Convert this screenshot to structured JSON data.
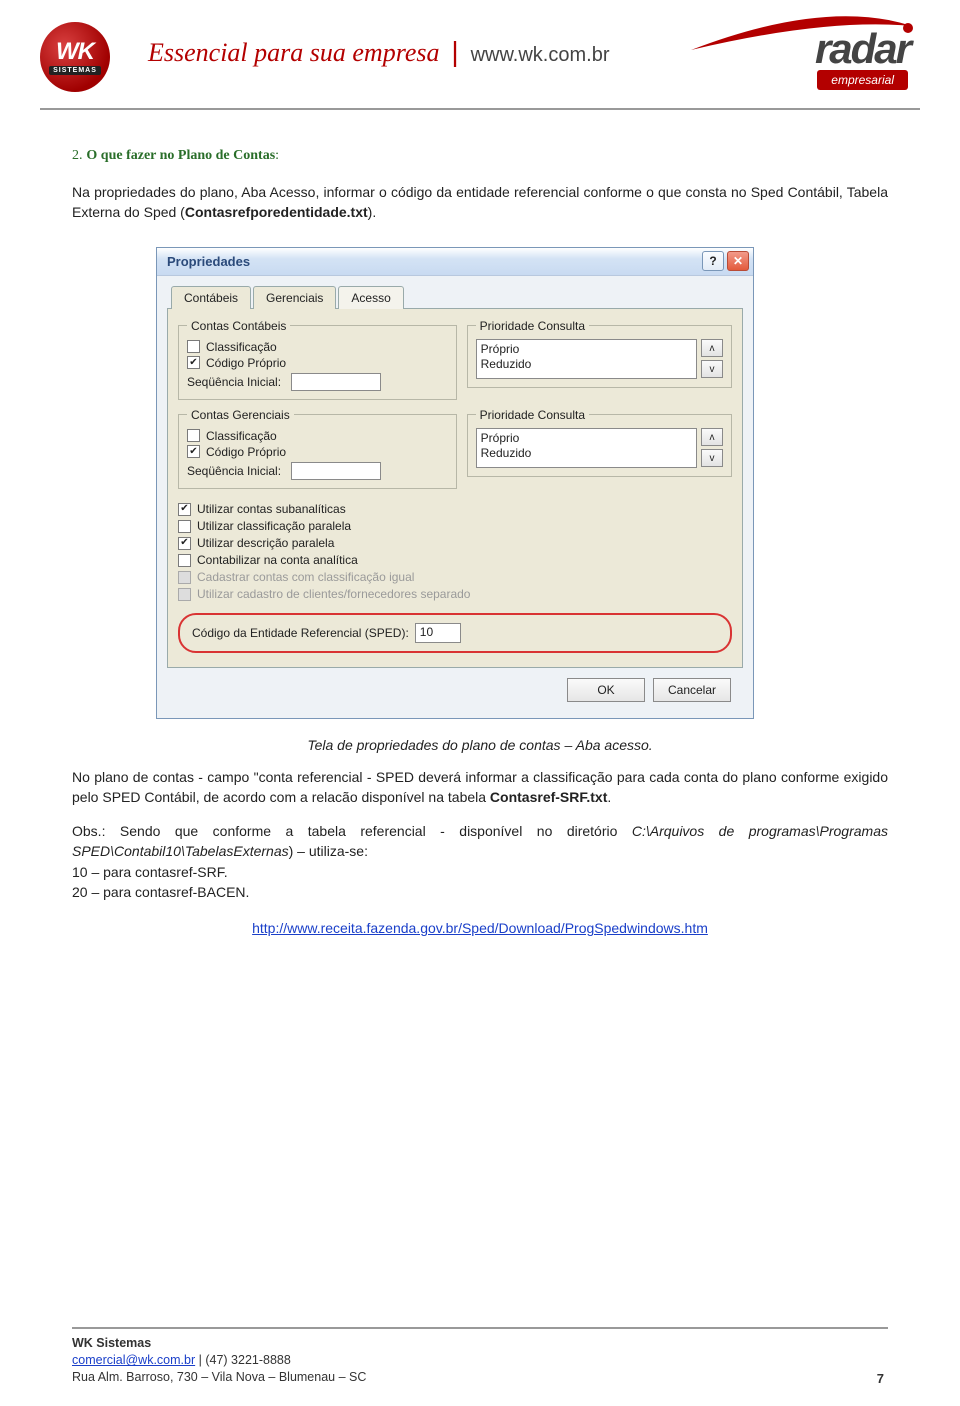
{
  "header": {
    "wk_text": "WK",
    "wk_sub": "SISTEMAS",
    "tagline": "Essencial para sua empresa",
    "site": "www.wk.com.br",
    "radar": "radar",
    "radar_sub": "empresarial"
  },
  "section": {
    "num": "2.",
    "title": "O que fazer no Plano de Contas",
    "colon": ":",
    "intro": "Na propriedades do plano, Aba Acesso, informar o código da entidade referencial conforme o que consta no Sped Contábil, Tabela Externa do Sped (",
    "intro_bold": "Contasrefporedentidade.txt",
    "intro_end": ")."
  },
  "dialog": {
    "title": "Propriedades",
    "help": "?",
    "close": "✕",
    "tabs": [
      "Contábeis",
      "Gerenciais",
      "Acesso"
    ],
    "groups": {
      "contas_contabeis": {
        "legend": "Contas Contábeis",
        "classificacao": "Classificação",
        "codigo_proprio": "Código Próprio",
        "sequencia": "Seqüência Inicial:"
      },
      "contas_gerenciais": {
        "legend": "Contas Gerenciais",
        "classificacao": "Classificação",
        "codigo_proprio": "Código Próprio",
        "sequencia": "Seqüência Inicial:"
      },
      "prioridade1": {
        "legend": "Prioridade Consulta",
        "items": [
          "Próprio",
          "Reduzido"
        ]
      },
      "prioridade2": {
        "legend": "Prioridade Consulta",
        "items": [
          "Próprio",
          "Reduzido"
        ]
      }
    },
    "options": [
      {
        "label": "Utilizar contas subanalíticas",
        "checked": true,
        "disabled": false
      },
      {
        "label": "Utilizar classificação paralela",
        "checked": false,
        "disabled": false
      },
      {
        "label": "Utilizar descrição paralela",
        "checked": true,
        "disabled": false
      },
      {
        "label": "Contabilizar na conta analítica",
        "checked": false,
        "disabled": false
      },
      {
        "label": "Cadastrar contas com classificação igual",
        "checked": false,
        "disabled": true
      },
      {
        "label": "Utilizar cadastro de clientes/fornecedores separado",
        "checked": false,
        "disabled": true
      }
    ],
    "sped_label": "Código da Entidade Referencial (SPED):",
    "sped_value": "10",
    "ok": "OK",
    "cancel": "Cancelar"
  },
  "caption": "Tela de propriedades do plano de contas – Aba acesso.",
  "para2_a": "No plano de contas - campo \"conta referencial - SPED deverá informar a classificação para cada conta do plano conforme exigido pelo SPED Contábil, de acordo com a relacão disponível na tabela ",
  "para2_b": "Contasref-SRF.txt",
  "para2_c": ".",
  "obs_a": "Obs.: Sendo que conforme a tabela referencial - disponível no diretório ",
  "obs_i": "C:\\Arquivos de programas\\Programas SPED\\Contabil10\\TabelasExternas",
  "obs_b": ") – utiliza-se:",
  "obs_l1": "10 – para contasref-SRF.",
  "obs_l2": "20 – para contasref-BACEN.",
  "link": "http://www.receita.fazenda.gov.br/Sped/Download/ProgSpedwindows.htm",
  "footer": {
    "company": "WK Sistemas",
    "email": "comercial@wk.com.br",
    "phone": " | (47) 3221-8888",
    "address": "Rua Alm. Barroso, 730 – Vila Nova – Blumenau – SC",
    "page": "7"
  },
  "spin": {
    "up": "ʌ",
    "down": "v"
  }
}
